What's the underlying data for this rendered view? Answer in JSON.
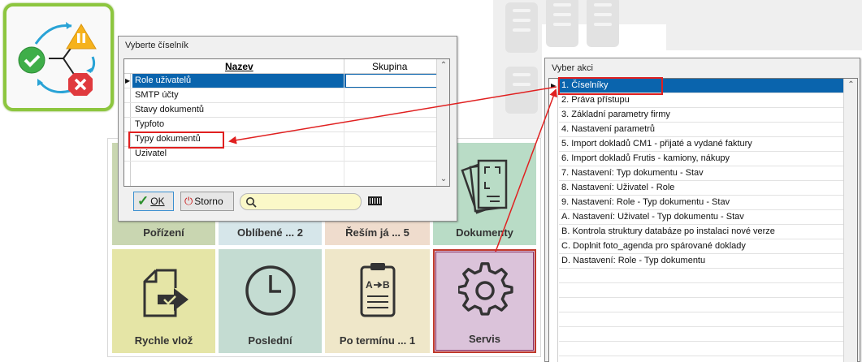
{
  "dialog_ciselnik": {
    "title": "Vyberte číselník",
    "col_name": "Nazev",
    "col_group": "Skupina",
    "rows": [
      "Role uživatelů",
      "SMTP účty",
      "Stavy dokumentů",
      "Typfoto",
      "Typy dokumentů",
      "Uzivatel"
    ],
    "ok_label": "OK",
    "storno_label": "Storno",
    "search_value": ""
  },
  "dialog_akce": {
    "title": "Vyber akci",
    "rows": [
      "1. Číselníky",
      "2. Práva přístupu",
      "3. Základní parametry firmy",
      "4. Nastavení parametrů",
      "5. Import dokladů CM1 - přijaté a vydané faktury",
      "6. Import dokladů Frutis - kamiony, nákupy",
      "7. Nastavení: Typ dokumentu - Stav",
      "8. Nastavení: Uživatel - Role",
      "9. Nastavení: Role - Typ dokumentu - Stav",
      "A. Nastavení: Uživatel - Typ dokumentu - Stav",
      "B. Kontrola struktury databáze po instalaci nové verze",
      "C. Doplnit foto_agenda pro spárované doklady",
      "D. Nastavení: Role - Typ dokumentu"
    ]
  },
  "tiles": {
    "porizeni": "Pořízení",
    "oblibene": "Oblíbené ... 2",
    "resim": "Řeším já  ... 5",
    "dokumenty": "Dokumenty",
    "rychle_vloz": "Rychle vlož",
    "posledni": "Poslední",
    "po_terminu": "Po termínu ... 1",
    "servis": "Servis"
  },
  "colors": {
    "selection": "#0a64ad",
    "annotation_red": "#e02020",
    "tile_green": "#c9d6b1",
    "tile_blue": "#d6e6ea",
    "tile_peach": "#efdccd",
    "tile_mint": "#b9dcc6",
    "tile_olive": "#e5e5a6",
    "tile_sage": "#c4dcd2",
    "tile_beige": "#efe7c9",
    "tile_lilac": "#dbc3da"
  }
}
